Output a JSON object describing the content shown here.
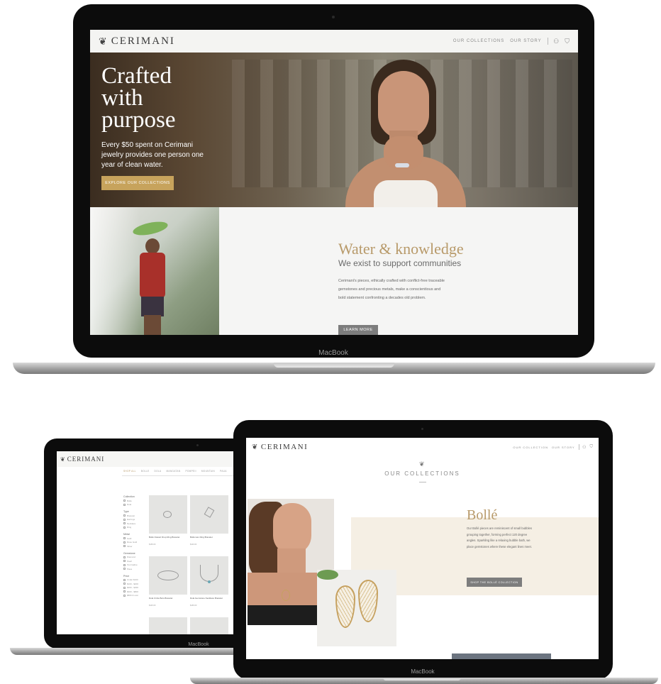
{
  "device_label": "MacBook",
  "main_site": {
    "brand": "CERIMANI",
    "nav": [
      "OUR COLLECTIONS",
      "OUR STORY"
    ],
    "hero": {
      "headline_lines": [
        "Crafted",
        "with",
        "purpose"
      ],
      "body": "Every $50 spent on Cerimani jewelry provides one person one year of clean water.",
      "cta": "EXPLORE OUR COLLECTIONS"
    },
    "mission": {
      "title": "Water & knowledge",
      "subtitle": "We exist to support communities",
      "body": "Cerimani's pieces, ethically crafted with conflict-free traceable gemstones and precious metals, make a conscientious and bold statement confronting a decades old problem.",
      "cta": "LEARN MORE"
    }
  },
  "shop_site": {
    "brand": "CERIMANI",
    "tabs": [
      "SHOP ALL",
      "BOLLE",
      "DOLA",
      "MANGATAN",
      "POMPEII",
      "MOUNTAIN",
      "PAUA"
    ],
    "filters": [
      {
        "title": "Collection",
        "options": [
          "Bollé",
          "Dola"
        ]
      },
      {
        "title": "Type",
        "options": [
          "Bracelet",
          "Earrings",
          "Necklace",
          "Ring"
        ]
      },
      {
        "title": "Metal",
        "options": [
          "Gold",
          "Rose Gold",
          "Silver"
        ]
      },
      {
        "title": "Gemstone",
        "options": [
          "Diamond",
          "Pearl",
          "Tourmaline",
          "Paua"
        ]
      },
      {
        "title": "Price",
        "options": [
          "Under $100",
          "$100 - $200",
          "$200 - $400",
          "$400 - $800",
          "$800 & over"
        ]
      }
    ],
    "products": [
      {
        "name": "Bollé Classic Drop Ring Bracelet",
        "price": "$165.00"
      },
      {
        "name": "Bollé Hex Ring Bracelet",
        "price": "$110.00"
      },
      {
        "name": "Dola Circle Bolo Bracelet",
        "price": "$145.00"
      },
      {
        "name": "Dola Gemstone Necklace Bracelet",
        "price": "$165.00"
      }
    ]
  },
  "collections_site": {
    "brand": "CERIMANI",
    "nav": [
      "OUR COLLECTION",
      "OUR STORY"
    ],
    "heading": "OUR COLLECTIONS",
    "collection": {
      "title": "Bollé",
      "body": "Our Bollé pieces are reminiscent of small bubbles grouping together, forming perfect 120 degree angles. Sparkling like a relaxing bubble bath, we place gemstones where these elegant lines meet.",
      "cta": "SHOP THE BOLLÉ COLLECTION"
    }
  },
  "colors": {
    "gold": "#c7a35c",
    "gold_text": "#b89a6a",
    "button_grey": "#7d7d7d"
  }
}
